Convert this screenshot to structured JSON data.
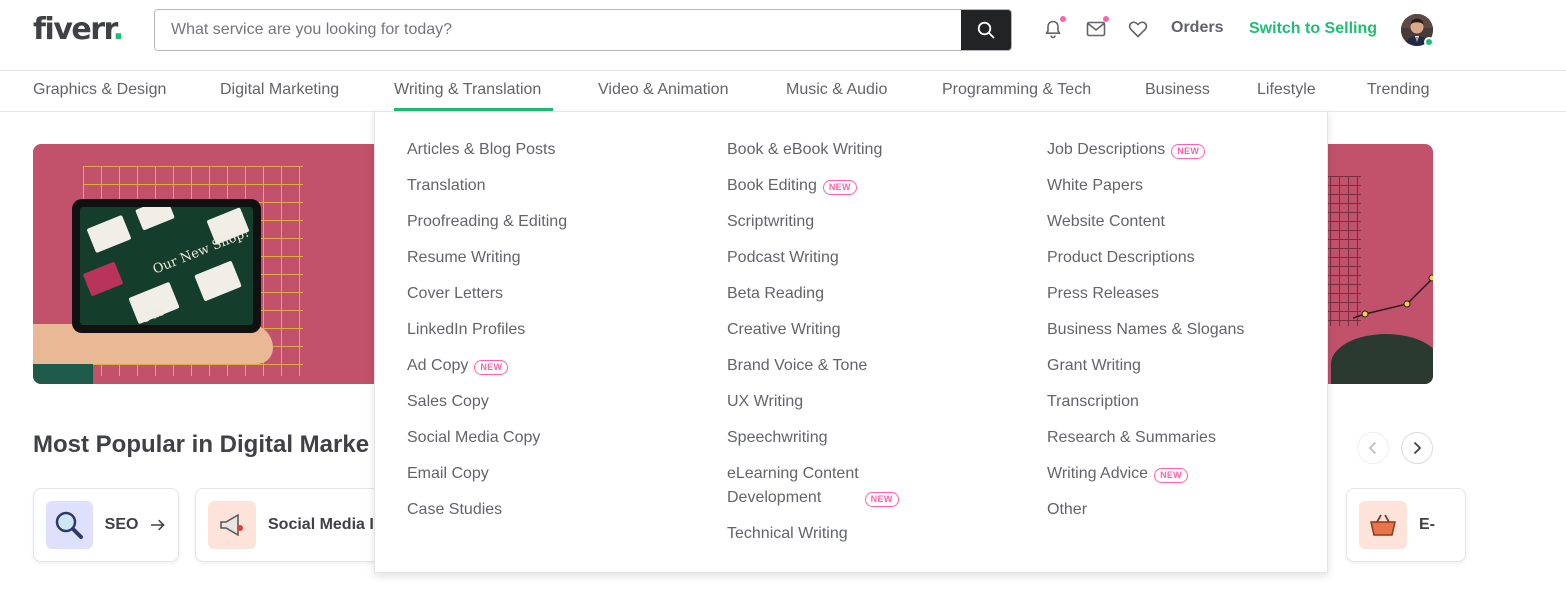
{
  "header": {
    "logo_text": "fiverr",
    "logo_dot": ".",
    "search_placeholder": "What service are you looking for today?",
    "orders_label": "Orders",
    "switch_label": "Switch to Selling",
    "accent_color": "#1dbf73",
    "notification_dot_color": "#ff62ad",
    "icons": [
      "search-icon",
      "bell-icon",
      "mail-icon",
      "heart-icon"
    ]
  },
  "categories": [
    "Graphics & Design",
    "Digital Marketing",
    "Writing & Translation",
    "Video & Animation",
    "Music & Audio",
    "Programming & Tech",
    "Business",
    "Lifestyle",
    "Trending"
  ],
  "active_category": "Writing & Translation",
  "banner": {
    "shop_text": "Our New Shop!",
    "shop_text_2": "Our"
  },
  "section": {
    "title": "Most Popular in Digital Marke",
    "tiles": [
      {
        "label": "SEO",
        "icon": "magnifier-icon"
      },
      {
        "label": "Social Media I",
        "icon": "megaphone-icon"
      },
      {
        "label": "E-",
        "icon": "basket-icon"
      }
    ]
  },
  "dropdown": {
    "new_label": "NEW",
    "col1": [
      {
        "label": "Articles & Blog Posts"
      },
      {
        "label": "Translation"
      },
      {
        "label": "Proofreading & Editing"
      },
      {
        "label": "Resume Writing"
      },
      {
        "label": "Cover Letters"
      },
      {
        "label": "LinkedIn Profiles"
      },
      {
        "label": "Ad Copy",
        "new": true
      },
      {
        "label": "Sales Copy"
      },
      {
        "label": "Social Media Copy"
      },
      {
        "label": "Email Copy"
      },
      {
        "label": "Case Studies"
      }
    ],
    "col2": [
      {
        "label": "Book & eBook Writing"
      },
      {
        "label": "Book Editing",
        "new": true
      },
      {
        "label": "Scriptwriting"
      },
      {
        "label": "Podcast Writing"
      },
      {
        "label": "Beta Reading"
      },
      {
        "label": "Creative Writing"
      },
      {
        "label": "Brand Voice & Tone"
      },
      {
        "label": "UX Writing"
      },
      {
        "label": "Speechwriting"
      },
      {
        "label": "eLearning Content\nDevelopment",
        "new": true
      },
      {
        "label": "Technical Writing"
      }
    ],
    "col3": [
      {
        "label": "Job Descriptions",
        "new": true
      },
      {
        "label": "White Papers"
      },
      {
        "label": "Website Content"
      },
      {
        "label": "Product Descriptions"
      },
      {
        "label": "Press Releases"
      },
      {
        "label": "Business Names & Slogans"
      },
      {
        "label": "Grant Writing"
      },
      {
        "label": "Transcription"
      },
      {
        "label": "Research & Summaries"
      },
      {
        "label": "Writing Advice",
        "new": true
      },
      {
        "label": "Other"
      }
    ]
  }
}
